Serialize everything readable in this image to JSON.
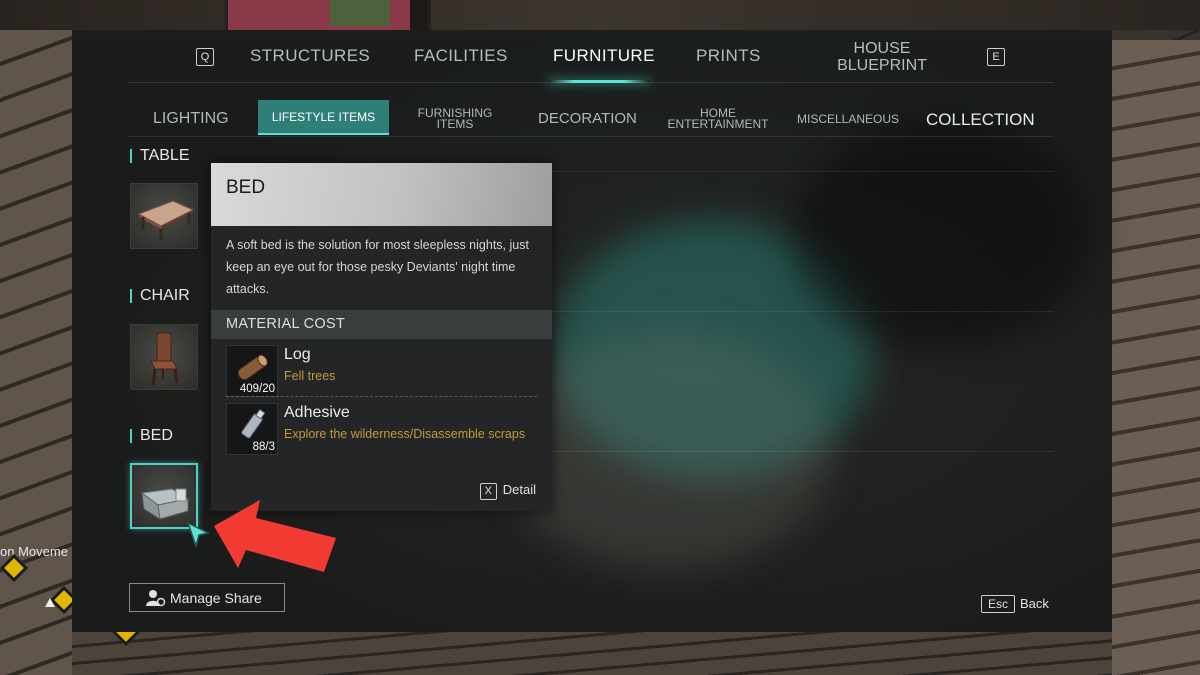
{
  "colors": {
    "accent": "#4fd1c5",
    "active_tab_bg": "#2e7f78",
    "source_text": "#c49b3c",
    "annotation_arrow": "#f03a32"
  },
  "background": {
    "side_text": "on Moveme"
  },
  "main_tabs": {
    "prev_key": "Q",
    "next_key": "E",
    "items": [
      {
        "label": "STRUCTURES"
      },
      {
        "label": "FACILITIES"
      },
      {
        "label": "FURNITURE",
        "active": true
      },
      {
        "label": "PRINTS"
      }
    ],
    "house_line1": "HOUSE",
    "house_line2": "BLUEPRINT"
  },
  "sub_tabs": {
    "lighting": "LIGHTING",
    "lifestyle": "LIFESTYLE ITEMS",
    "furnishing_1": "FURNISHING",
    "furnishing_2": "ITEMS",
    "decoration": "DECORATION",
    "home_1": "HOME",
    "home_2": "ENTERTAINMENT",
    "misc": "MISCELLANEOUS",
    "collection": "COLLECTION",
    "active": "LIFESTYLE ITEMS"
  },
  "categories": [
    {
      "title": "TABLE",
      "icon": "table-icon"
    },
    {
      "title": "CHAIR",
      "icon": "chair-icon"
    },
    {
      "title": "BED",
      "icon": "bed-icon",
      "selected": true
    }
  ],
  "popup": {
    "title": "BED",
    "description": "A soft bed is the solution for most sleepless nights, just keep an eye out for those pesky Deviants' night time attacks.",
    "material_header": "MATERIAL COST",
    "materials": [
      {
        "name": "Log",
        "count": "409/20",
        "source": "Fell trees",
        "icon": "log-icon"
      },
      {
        "name": "Adhesive",
        "count": "88/3",
        "source": "Explore the wilderness/Disassemble scraps",
        "icon": "adhesive-icon"
      }
    ],
    "detail_key": "X",
    "detail_label": "Detail"
  },
  "footer": {
    "manage_share": "Manage Share",
    "back_key": "Esc",
    "back_label": "Back"
  }
}
